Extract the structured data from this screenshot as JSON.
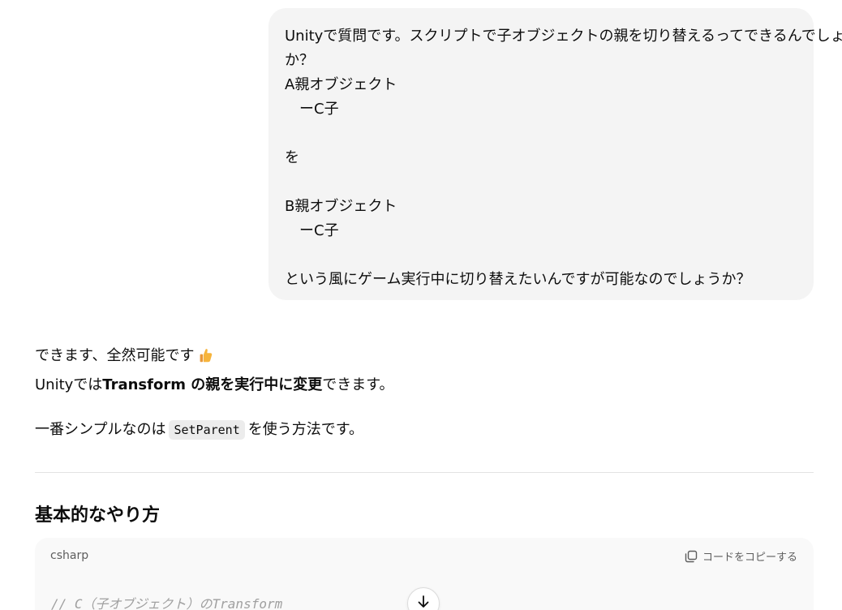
{
  "user_message": {
    "lines": [
      "Unityで質問です。スクリプトで子オブジェクトの親を切り替えるってできるんでしょう",
      "か？",
      "A親オブジェクト",
      "　ーC子",
      "",
      "を",
      "",
      "B親オブジェクト",
      "　ーC子",
      "",
      "という風にゲーム実行中に切り替えたいんですが可能なのでしょうか？"
    ]
  },
  "assistant": {
    "line1": "できます、全然可能です",
    "line1_emoji": "thumbs-up-icon",
    "line2_pre": "Unityでは",
    "line2_bold": "Transform の親を実行中に変更",
    "line2_post": "できます。",
    "line3_pre": "一番シンプルなのは",
    "line3_code": "SetParent",
    "line3_post": "を使う方法です。",
    "section_heading": "基本的なやり方",
    "code_block": {
      "language": "csharp",
      "copy_label": "コードをコピーする",
      "first_line": "// C（子オブジェクト）のTransform"
    }
  },
  "colors": {
    "bubble_bg": "#f4f4f4",
    "code_bg": "#f9f9f9",
    "inline_code_bg": "#ececec",
    "comment": "#a0a0a0"
  }
}
